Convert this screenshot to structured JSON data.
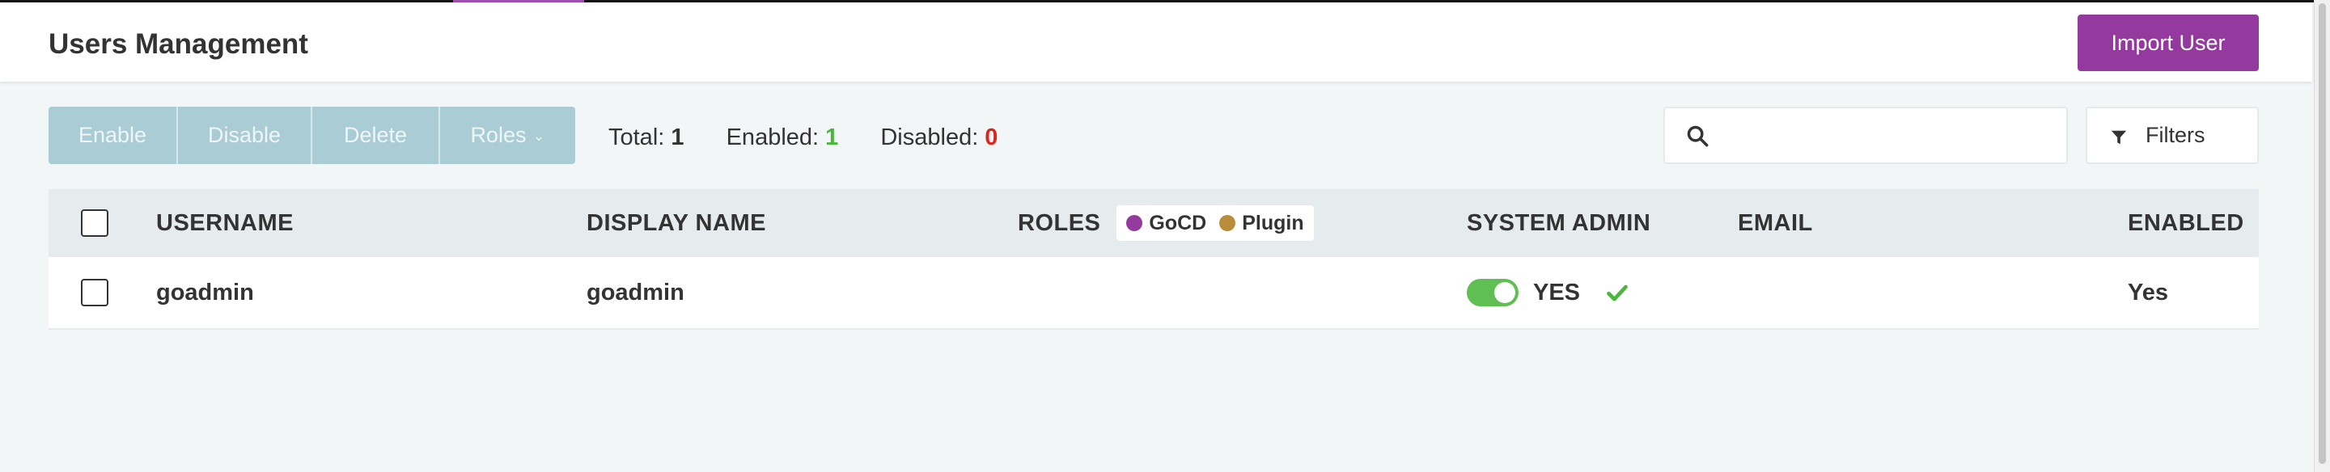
{
  "header": {
    "title": "Users Management",
    "import_label": "Import User"
  },
  "toolbar": {
    "enable_label": "Enable",
    "disable_label": "Disable",
    "delete_label": "Delete",
    "roles_label": "Roles",
    "total_label": "Total:",
    "total_value": "1",
    "enabled_label": "Enabled:",
    "enabled_value": "1",
    "disabled_label": "Disabled:",
    "disabled_value": "0"
  },
  "search": {
    "placeholder": "",
    "icon": "search-icon"
  },
  "filters": {
    "label": "Filters",
    "icon": "filter-icon"
  },
  "table": {
    "columns": {
      "username": "USERNAME",
      "display_name": "DISPLAY NAME",
      "roles": "ROLES",
      "system_admin": "SYSTEM ADMIN",
      "email": "EMAIL",
      "enabled": "ENABLED"
    },
    "role_legend": [
      {
        "label": "GoCD",
        "color": "#943a9e"
      },
      {
        "label": "Plugin",
        "color": "#b88d3a"
      }
    ],
    "rows": [
      {
        "username": "goadmin",
        "display_name": "goadmin",
        "roles": "",
        "system_admin_toggle": true,
        "system_admin_label": "YES",
        "email": "",
        "enabled": "Yes"
      }
    ]
  },
  "colors": {
    "primary": "#943a9e",
    "toolbar_button": "#a9ccd5",
    "success": "#4ab63b",
    "danger": "#d9271f",
    "toggle_on": "#5fbf52"
  }
}
